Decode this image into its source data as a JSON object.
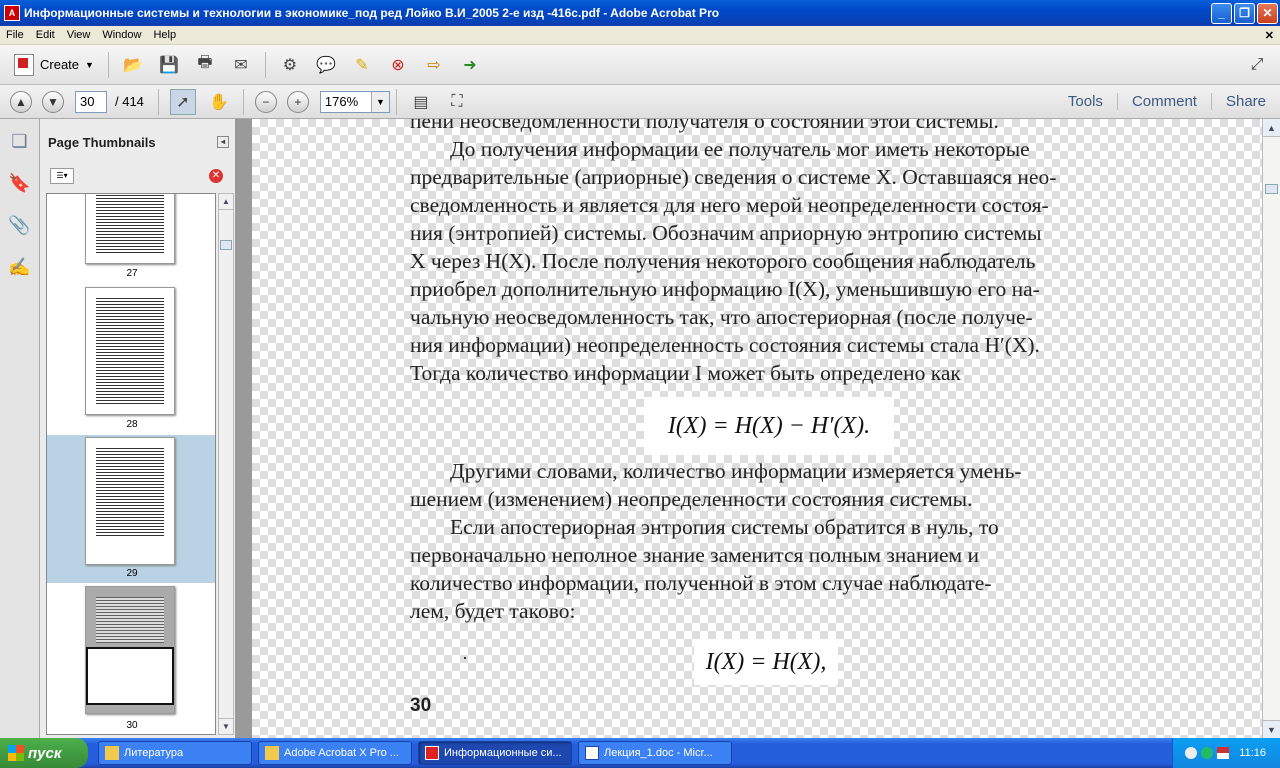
{
  "window": {
    "title": "Информационные системы и технологии в экономике_под ред Лойко В.И_2005 2-е изд -416с.pdf - Adobe Acrobat Pro"
  },
  "menu": [
    "File",
    "Edit",
    "View",
    "Window",
    "Help"
  ],
  "toolbar": {
    "create_label": "Create"
  },
  "nav": {
    "current_page": "30",
    "total_pages": "/ 414",
    "zoom": "176%"
  },
  "right_links": {
    "tools": "Tools",
    "comment": "Comment",
    "share": "Share"
  },
  "panel": {
    "title": "Page Thumbnails"
  },
  "thumbnails": [
    {
      "label": "27"
    },
    {
      "label": "28"
    },
    {
      "label": "29"
    },
    {
      "label": "30"
    }
  ],
  "document": {
    "top_line": "пени неосведомленности получателя о состоянии этой системы.",
    "p1_lines": [
      "До получения информации ее получатель мог иметь некоторые",
      "предварительные (априорные) сведения о системе X. Оставшаяся нео-",
      "сведомленность и является для него мерой неопределенности состоя-",
      "ния (энтропией) системы. Обозначим априорную энтропию системы",
      "X через H(X). После получения некоторого сообщения наблюдатель",
      "приобрел дополнительную информацию I(X), уменьшившую его на-",
      "чальную неосведомленность так, что апостериорная (после получе-",
      "ния информации) неопределенность состояния системы стала H′(X).",
      "Тогда количество информации I может быть определено как"
    ],
    "formula1": "I(X) = H(X) − H′(X).",
    "p2_lines": [
      "Другими словами, количество информации измеряется умень-",
      "шением (изменением) неопределенности состояния системы."
    ],
    "p3_lines": [
      "Если апостериорная энтропия системы обратится в нуль, то",
      "первоначально неполное знание заменится полным знанием и",
      "количество информации, полученной в этом случае наблюдате-",
      "лем, будет таково:"
    ],
    "formula2": "I(X) = H(X),",
    "page_number": "30"
  },
  "taskbar": {
    "start": "пуск",
    "tasks": [
      "Литература",
      "Adobe Acrobat X Pro ...",
      "Информационные си...",
      "Лекция_1.doc - Micr..."
    ],
    "clock": "11:16"
  },
  "colors": {
    "title_blue": "#0a5fd8",
    "taskbar_blue": "#245edb",
    "start_green": "#378a37",
    "thumb_selected": "#b9d2e4"
  }
}
